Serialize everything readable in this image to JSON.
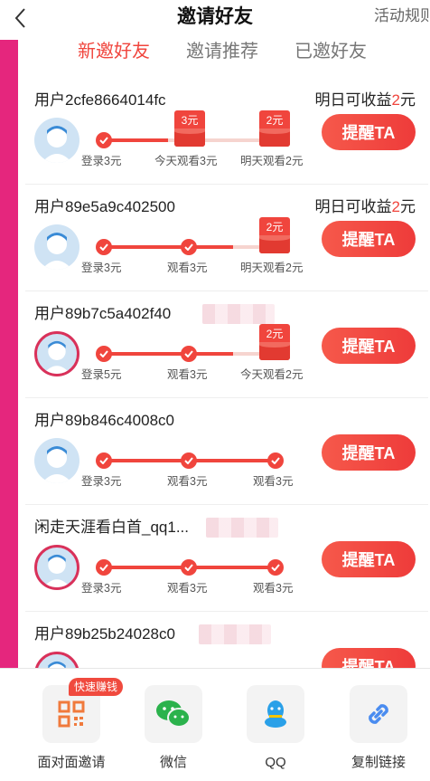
{
  "header": {
    "title": "邀请好友",
    "rules_label": "活动规则"
  },
  "tabs": [
    {
      "label": "新邀好友",
      "active": true
    },
    {
      "label": "邀请推荐",
      "active": false
    },
    {
      "label": "已邀好友",
      "active": false
    }
  ],
  "rows": [
    {
      "name": "用户2cfe8664014fc",
      "earn_prefix": "明日可收益",
      "earn_amount": "2",
      "earn_suffix": "元",
      "steps": [
        "登录3元",
        "今天观看3元",
        "明天观看2元"
      ],
      "envelopes": [
        "3元",
        "2元"
      ],
      "remind": "提醒TA"
    },
    {
      "name": "用户89e5a9c402500",
      "earn_prefix": "明日可收益",
      "earn_amount": "2",
      "earn_suffix": "元",
      "steps": [
        "登录3元",
        "观看3元",
        "明天观看2元"
      ],
      "envelopes": [
        "2元"
      ],
      "remind": "提醒TA"
    },
    {
      "name": "用户89b7c5a402f40",
      "steps": [
        "登录5元",
        "观看3元",
        "今天观看2元"
      ],
      "envelopes": [
        "2元"
      ],
      "remind": "提醒TA"
    },
    {
      "name": "用户89b846c4008c0",
      "steps": [
        "登录3元",
        "观看3元",
        "观看3元"
      ],
      "remind": "提醒TA"
    },
    {
      "name": "闲走天涯看白首_qq1...",
      "steps": [
        "登录3元",
        "观看3元",
        "观看3元"
      ],
      "remind": "提醒TA"
    },
    {
      "name": "用户89b25b24028c0",
      "remind": "提醒TA"
    }
  ],
  "share": {
    "badge": "快速赚钱",
    "items": [
      {
        "label": "面对面邀请",
        "icon": "qrcode-icon"
      },
      {
        "label": "微信",
        "icon": "wechat-icon"
      },
      {
        "label": "QQ",
        "icon": "qq-icon"
      },
      {
        "label": "复制链接",
        "icon": "link-icon"
      }
    ]
  },
  "colors": {
    "accent": "#f0453d",
    "strip": "#e5267d"
  }
}
